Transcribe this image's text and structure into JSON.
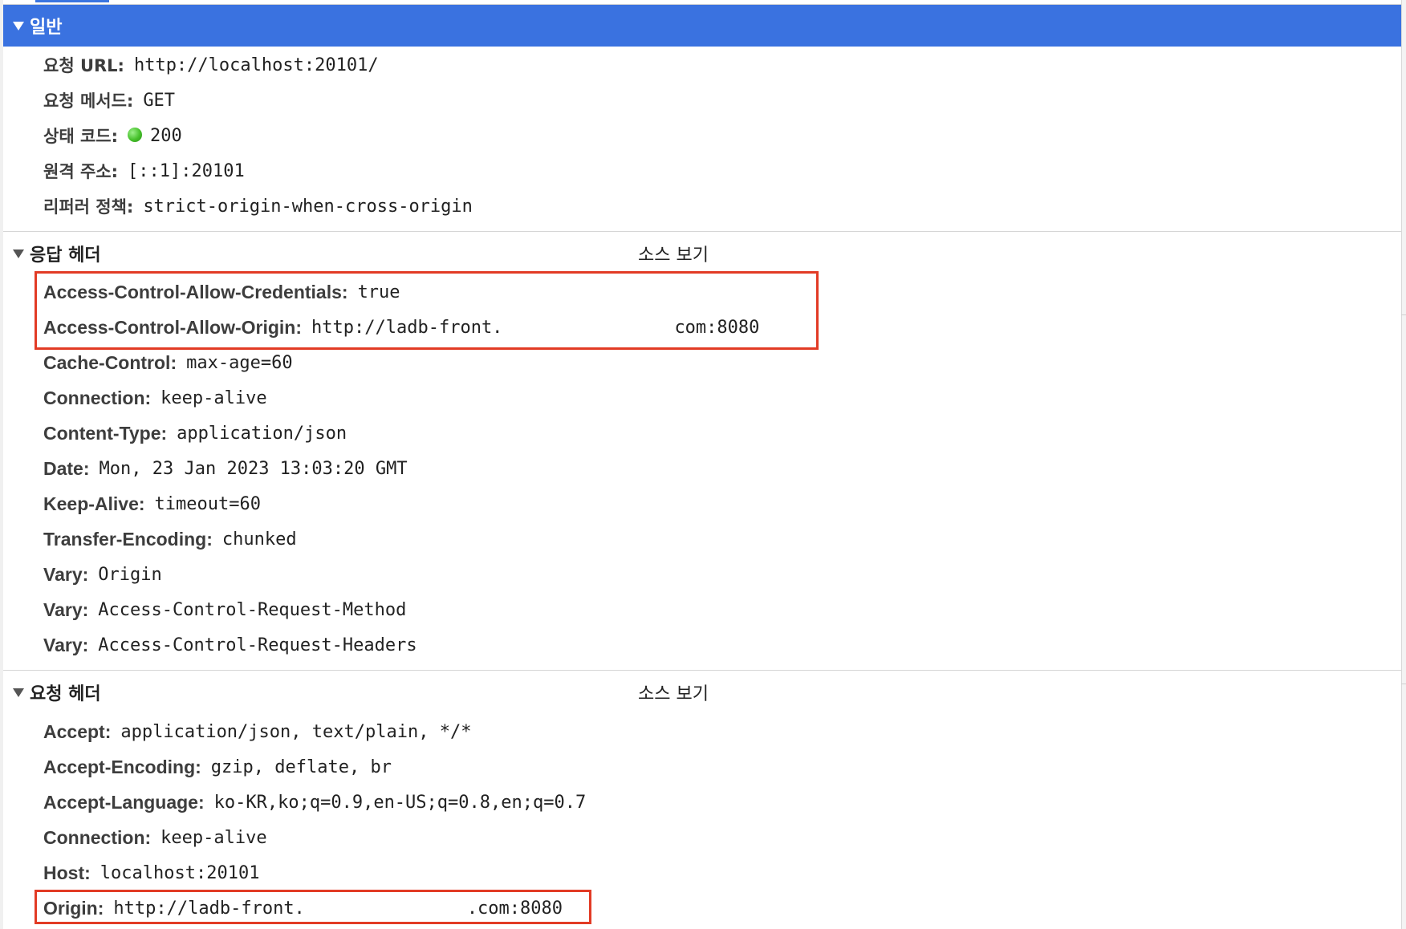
{
  "accent_color": "#3a72e0",
  "highlight_color": "#e23b25",
  "status_color": "#45c02a",
  "general": {
    "title": "일반",
    "icon": "twisty-expanded-icon",
    "rows": [
      {
        "key": "요청 URL:",
        "value": "http://localhost:20101/"
      },
      {
        "key": "요청 메서드:",
        "value": "GET"
      },
      {
        "key": "상태 코드:",
        "value": "200",
        "icon": "status-ok-dot-icon"
      },
      {
        "key": "원격 주소:",
        "value": "[::1]:20101"
      },
      {
        "key": "리퍼러 정책:",
        "value": "strict-origin-when-cross-origin"
      }
    ]
  },
  "response_headers": {
    "title": "응답 헤더",
    "view_source": "소스 보기",
    "rows": [
      {
        "key": "Access-Control-Allow-Credentials:",
        "value": "true"
      },
      {
        "key": "Access-Control-Allow-Origin:",
        "value": "http://ladb-front.",
        "value_tail": "com:8080"
      },
      {
        "key": "Cache-Control:",
        "value": "max-age=60"
      },
      {
        "key": "Connection:",
        "value": "keep-alive"
      },
      {
        "key": "Content-Type:",
        "value": "application/json"
      },
      {
        "key": "Date:",
        "value": "Mon, 23 Jan 2023 13:03:20 GMT"
      },
      {
        "key": "Keep-Alive:",
        "value": "timeout=60"
      },
      {
        "key": "Transfer-Encoding:",
        "value": "chunked"
      },
      {
        "key": "Vary:",
        "value": "Origin"
      },
      {
        "key": "Vary:",
        "value": "Access-Control-Request-Method"
      },
      {
        "key": "Vary:",
        "value": "Access-Control-Request-Headers"
      }
    ]
  },
  "request_headers": {
    "title": "요청 헤더",
    "view_source": "소스 보기",
    "rows": [
      {
        "key": "Accept:",
        "value": "application/json, text/plain, */*"
      },
      {
        "key": "Accept-Encoding:",
        "value": "gzip, deflate, br"
      },
      {
        "key": "Accept-Language:",
        "value": "ko-KR,ko;q=0.9,en-US;q=0.8,en;q=0.7"
      },
      {
        "key": "Connection:",
        "value": "keep-alive"
      },
      {
        "key": "Host:",
        "value": "localhost:20101"
      },
      {
        "key": "Origin:",
        "value": "http://ladb-front.",
        "value_tail": ".com:8080"
      }
    ]
  }
}
